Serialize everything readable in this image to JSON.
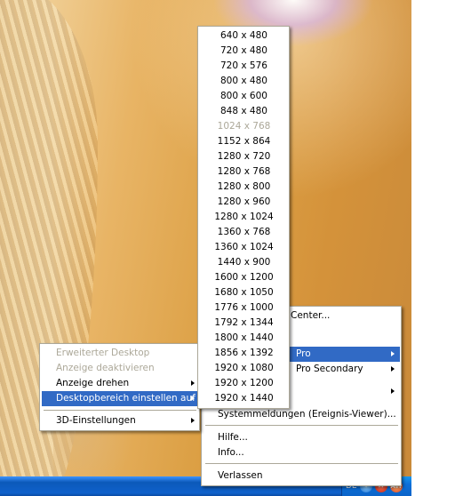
{
  "resolution_menu": {
    "items": [
      {
        "label": "640 x 480",
        "disabled": false
      },
      {
        "label": "720 x 480",
        "disabled": false
      },
      {
        "label": "720 x 576",
        "disabled": false
      },
      {
        "label": "800 x 480",
        "disabled": false
      },
      {
        "label": "800 x 600",
        "disabled": false
      },
      {
        "label": "848 x 480",
        "disabled": false
      },
      {
        "label": "1024 x 768",
        "disabled": true
      },
      {
        "label": "1152 x 864",
        "disabled": false
      },
      {
        "label": "1280 x 720",
        "disabled": false
      },
      {
        "label": "1280 x 768",
        "disabled": false
      },
      {
        "label": "1280 x 800",
        "disabled": false
      },
      {
        "label": "1280 x 960",
        "disabled": false
      },
      {
        "label": "1280 x 1024",
        "disabled": false
      },
      {
        "label": "1360 x 768",
        "disabled": false
      },
      {
        "label": "1360 x 1024",
        "disabled": false
      },
      {
        "label": "1440 x 900",
        "disabled": false
      },
      {
        "label": "1600 x 1200",
        "disabled": false
      },
      {
        "label": "1680 x 1050",
        "disabled": false
      },
      {
        "label": "1776 x 1000",
        "disabled": false
      },
      {
        "label": "1792 x 1344",
        "disabled": false
      },
      {
        "label": "1800 x 1440",
        "disabled": false
      },
      {
        "label": "1856 x 1392",
        "disabled": false
      },
      {
        "label": "1920 x 1080",
        "disabled": false
      },
      {
        "label": "1920 x 1200",
        "disabled": false
      },
      {
        "label": "1920 x 1440",
        "disabled": false
      }
    ]
  },
  "display_menu": {
    "items": [
      {
        "label": "Erweiterter Desktop",
        "disabled": true
      },
      {
        "label": "Anzeige deaktivieren",
        "disabled": true
      },
      {
        "label": "Anzeige drehen",
        "submenu": true
      },
      {
        "label": "Desktopbereich einstellen auf",
        "submenu": true,
        "highlighted": true
      }
    ],
    "footer_item": {
      "label": "3D-Einstellungen",
      "submenu": true
    }
  },
  "main_menu": {
    "items": {
      "center": "Center...",
      "pro": "Pro",
      "pro_secondary": "Pro Secondary",
      "system_messages": "Systemmeldungen (Ereignis-Viewer)...",
      "help": "Hilfe...",
      "info": "Info...",
      "exit": "Verlassen"
    }
  },
  "taskbar": {
    "language": "DE",
    "tray_icons": [
      "network-icon",
      "security-alert-icon",
      "ati-catalyst-icon"
    ]
  },
  "colors": {
    "highlight": "#316ac5",
    "disabled_text": "#aca899",
    "menu_border": "#aca899"
  }
}
